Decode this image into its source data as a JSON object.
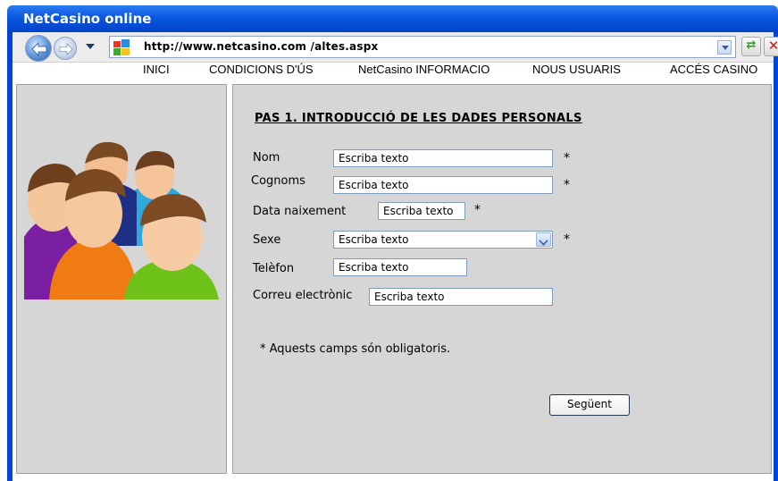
{
  "window": {
    "title": "NetCasino online"
  },
  "toolbar": {
    "back_icon": "back-arrow-icon",
    "forward_icon": "forward-arrow-icon",
    "url": "http://www.netcasino.com /altes.aspx",
    "go_icon": "go-arrows-icon",
    "stop_icon": "close-x-icon"
  },
  "menu": {
    "items": [
      {
        "label": "INICI"
      },
      {
        "label": "CONDICIONS D'ÚS"
      },
      {
        "label": "NetCasino INFORMACIO"
      },
      {
        "label": "NOUS USUARIS"
      },
      {
        "label": "ACCÉS CASINO"
      }
    ]
  },
  "sidebar": {
    "image_icon": "users-group-icon"
  },
  "form": {
    "heading": "PAS 1. INTRODUCCIÓ DE LES DADES PERSONALS",
    "fields": {
      "nom": {
        "label": "Nom",
        "value": "Escriba texto",
        "required": "*"
      },
      "cognoms": {
        "label": "Cognoms",
        "value": "Escriba texto",
        "required": "*"
      },
      "data_naixement": {
        "label": "Data naixement",
        "value": "Escriba texto",
        "required": "*"
      },
      "sexe": {
        "label": "Sexe",
        "value": "Escriba texto",
        "required": "*"
      },
      "telefon": {
        "label": "Telèfon",
        "value": "Escriba texto"
      },
      "correu": {
        "label": "Correu electrònic",
        "value": "Escriba texto"
      }
    },
    "required_note": "*  Aquests camps són obligatoris.",
    "next_label": "Següent"
  },
  "colors": {
    "titlebar": "#0a57e0",
    "panel_bg": "#d6d6d6",
    "input_border": "#7f9db9"
  }
}
